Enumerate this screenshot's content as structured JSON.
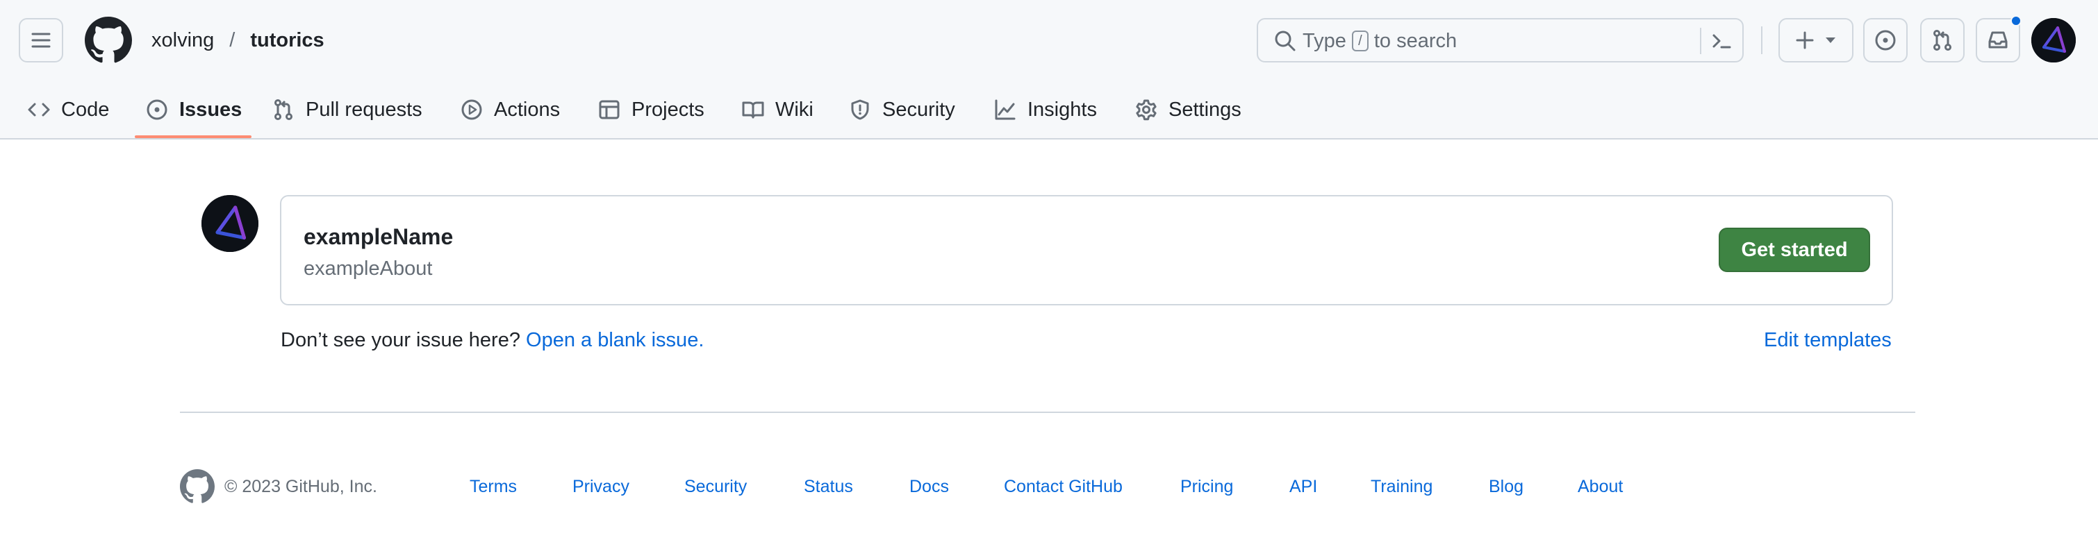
{
  "header": {
    "menu_icon": "hamburger-menu-icon",
    "logo_icon": "github-mark-icon",
    "breadcrumb": {
      "owner": "xolving",
      "separator": "/",
      "repo": "tutorics"
    },
    "search": {
      "placeholder_before": "Type",
      "key_hint": "/",
      "placeholder_after": "to search",
      "icon": "search-icon",
      "prompt_icon": "command-palette-icon"
    },
    "actions": {
      "create_icon": "plus-icon",
      "issues_icon": "issue-opened-icon",
      "pull_requests_icon": "git-pull-request-icon",
      "inbox_icon": "inbox-icon",
      "has_unread_notifications": true
    }
  },
  "repo_nav": {
    "tabs": [
      {
        "label": "Code",
        "icon": "code-icon",
        "selected": false
      },
      {
        "label": "Issues",
        "icon": "issue-opened-icon",
        "selected": true
      },
      {
        "label": "Pull requests",
        "icon": "git-pull-request-icon",
        "selected": false
      },
      {
        "label": "Actions",
        "icon": "play-icon",
        "selected": false
      },
      {
        "label": "Projects",
        "icon": "table-icon",
        "selected": false
      },
      {
        "label": "Wiki",
        "icon": "book-icon",
        "selected": false
      },
      {
        "label": "Security",
        "icon": "shield-icon",
        "selected": false
      },
      {
        "label": "Insights",
        "icon": "graph-icon",
        "selected": false
      },
      {
        "label": "Settings",
        "icon": "gear-icon",
        "selected": false
      }
    ]
  },
  "main": {
    "template": {
      "name": "exampleName",
      "about": "exampleAbout",
      "button_label": "Get started"
    },
    "blank_issue": {
      "prefix": "Don’t see your issue here?",
      "link_label": "Open a blank issue."
    },
    "edit_templates_label": "Edit templates"
  },
  "footer": {
    "copyright": "© 2023 GitHub, Inc.",
    "links": [
      "Terms",
      "Privacy",
      "Security",
      "Status",
      "Docs",
      "Contact GitHub",
      "Pricing",
      "API",
      "Training",
      "Blog",
      "About"
    ]
  },
  "colors": {
    "header_bg": "#f6f8fa",
    "link": "#0969da",
    "primary_button": "#3e8443",
    "selected_tab_underline": "#fd8c73",
    "notification_dot": "#0969da"
  }
}
